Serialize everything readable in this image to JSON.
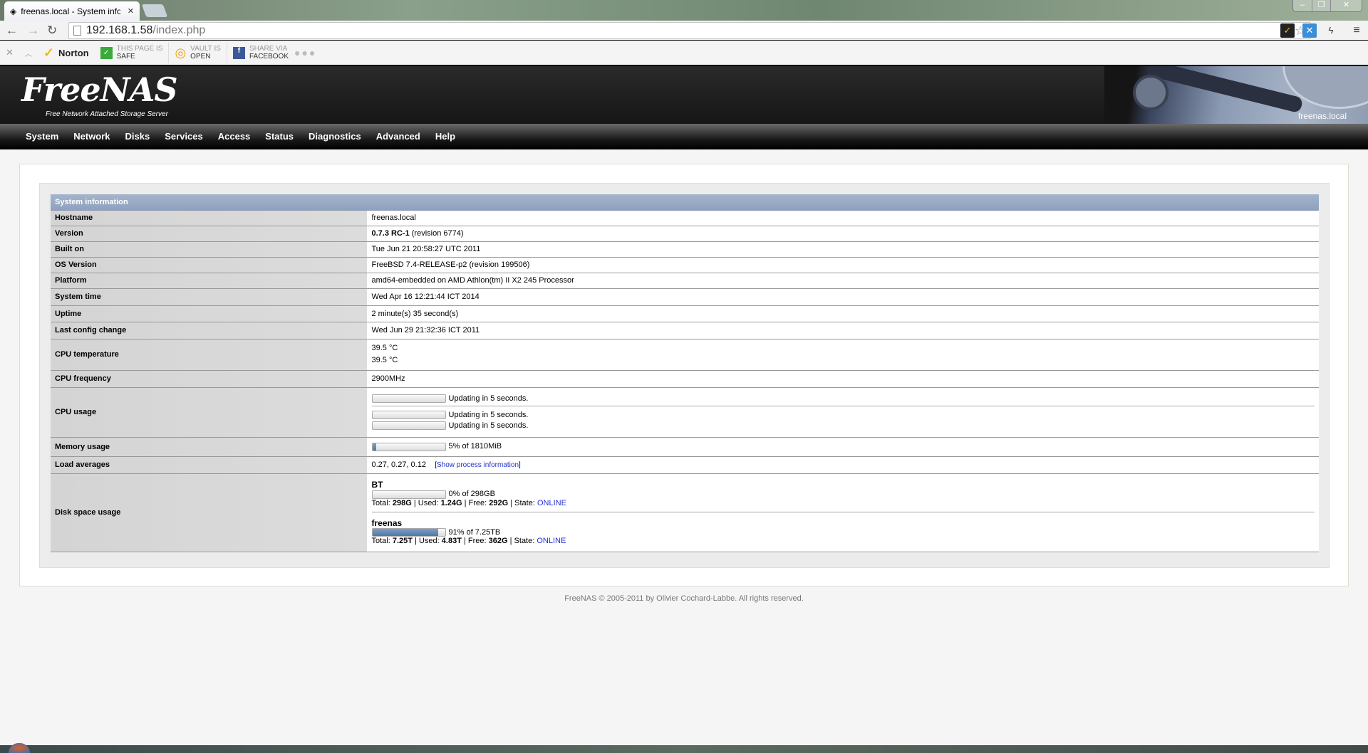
{
  "browser": {
    "tab_title": "freenas.local - System info",
    "url_host": "192.168.1.58",
    "url_path": "/index.php"
  },
  "norton": {
    "brand": "Norton",
    "safe_top": "THIS PAGE IS",
    "safe_bottom": "SAFE",
    "vault_top": "VAULT IS",
    "vault_bottom": "OPEN",
    "share_top": "SHARE VIA",
    "share_bottom": "FACEBOOK"
  },
  "header": {
    "logo": "FreeNAS",
    "tagline": "Free Network Attached Storage Server",
    "hostname": "freenas.local"
  },
  "menu": [
    "System",
    "Network",
    "Disks",
    "Services",
    "Access",
    "Status",
    "Diagnostics",
    "Advanced",
    "Help"
  ],
  "sysinfo": {
    "title": "System information",
    "hostname": {
      "label": "Hostname",
      "value": "freenas.local"
    },
    "version": {
      "label": "Version",
      "bold": "0.7.3 RC-1",
      "rest": " (revision 6774)"
    },
    "built_on": {
      "label": "Built on",
      "value": "Tue Jun 21 20:58:27 UTC 2011"
    },
    "os_version": {
      "label": "OS Version",
      "value": "FreeBSD 7.4-RELEASE-p2 (revision 199506)"
    },
    "platform": {
      "label": "Platform",
      "value": "amd64-embedded on AMD Athlon(tm) II X2 245 Processor"
    },
    "system_time": {
      "label": "System time",
      "value": "Wed Apr 16 12:21:44 ICT 2014"
    },
    "uptime": {
      "label": "Uptime",
      "value": "2 minute(s) 35 second(s)"
    },
    "last_config": {
      "label": "Last config change",
      "value": "Wed Jun 29 21:32:36 ICT 2011"
    },
    "cpu_temp": {
      "label": "CPU temperature",
      "values": [
        "39.5  °C",
        "39.5  °C"
      ]
    },
    "cpu_freq": {
      "label": "CPU frequency",
      "value": "2900MHz"
    },
    "cpu_usage": {
      "label": "CPU usage",
      "bars": [
        {
          "percent": 0,
          "text": "Updating in 5 seconds."
        },
        {
          "percent": 0,
          "text": "Updating in 5 seconds."
        },
        {
          "percent": 0,
          "text": "Updating in 5 seconds."
        }
      ]
    },
    "memory": {
      "label": "Memory usage",
      "percent": 5,
      "text": "5% of 1810MiB"
    },
    "load": {
      "label": "Load averages",
      "value": "0.27, 0.27, 0.12",
      "link": "Show process information"
    },
    "disk": {
      "label": "Disk space usage",
      "pools": [
        {
          "name": "BT",
          "percent": 0,
          "text": "0% of 298GB",
          "total": "298G",
          "used": "1.24G",
          "free": "292G",
          "state": "ONLINE"
        },
        {
          "name": "freenas",
          "percent": 91,
          "text": "91% of 7.25TB",
          "total": "7.25T",
          "used": "4.83T",
          "free": "362G",
          "state": "ONLINE"
        }
      ],
      "total_label": "Total: ",
      "used_label": "Used: ",
      "free_label": "Free: ",
      "state_label": "State: "
    }
  },
  "footer": "FreeNAS © 2005-2011 by Olivier Cochard-Labbe. All rights reserved."
}
